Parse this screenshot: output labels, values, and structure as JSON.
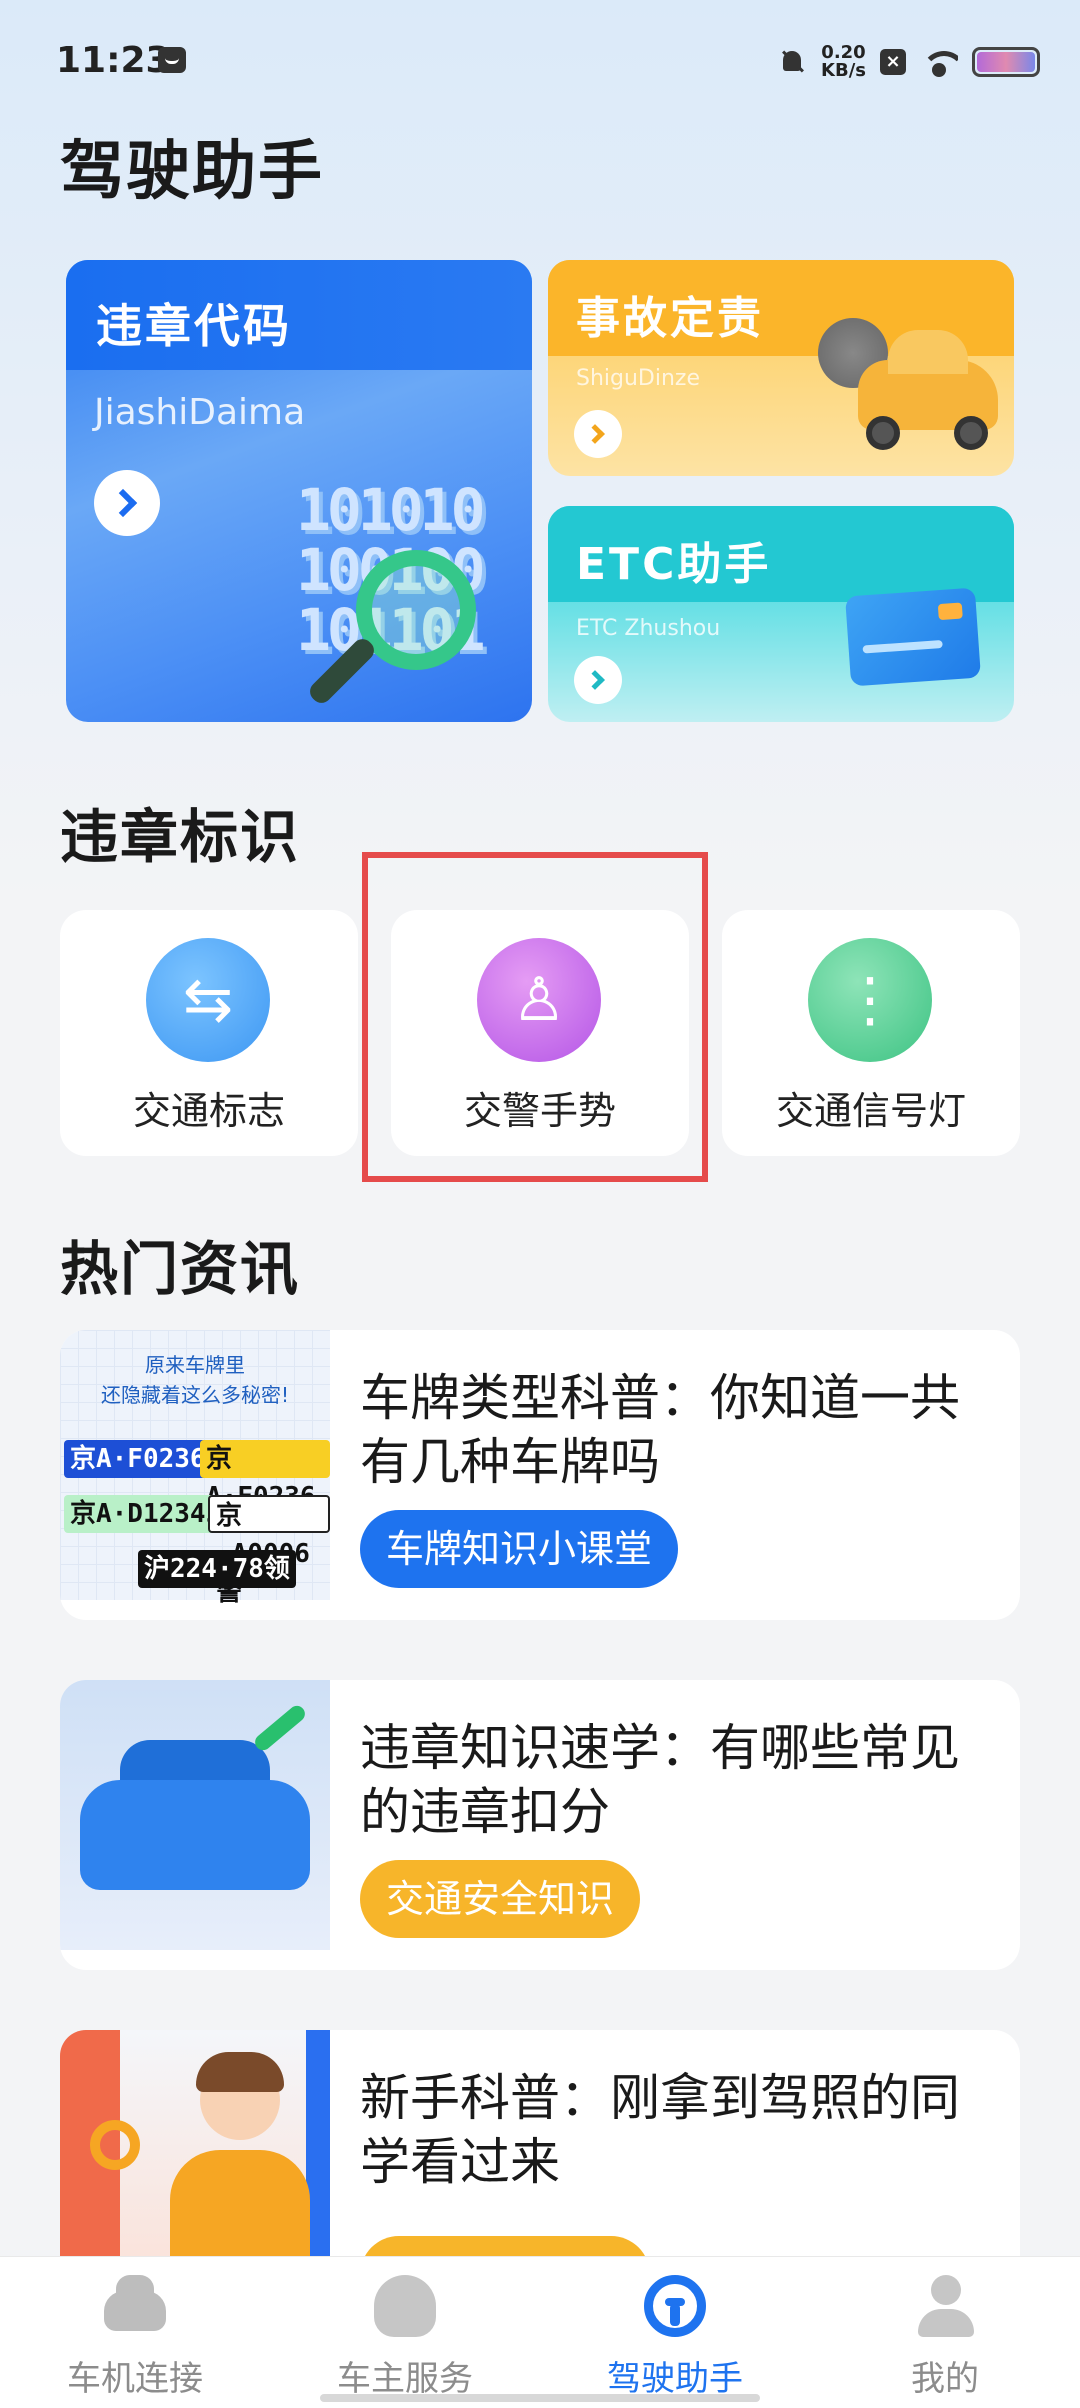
{
  "status_bar": {
    "time": "11:23",
    "net_speed": "0.20",
    "net_unit": "KB/s"
  },
  "page_title": "驾驶助手",
  "feature_cards": [
    {
      "title": "违章代码",
      "subtitle": "JiashiDaima"
    },
    {
      "title": "事故定责",
      "subtitle": "ShiguDinze"
    },
    {
      "title": "ETC助手",
      "subtitle": "ETC Zhushou"
    }
  ],
  "signs_section": {
    "title": "违章标识",
    "items": [
      {
        "label": "交通标志",
        "icon": "road-sign-icon"
      },
      {
        "label": "交警手势",
        "icon": "traffic-police-icon"
      },
      {
        "label": "交通信号灯",
        "icon": "traffic-light-icon"
      }
    ]
  },
  "news_section": {
    "title": "热门资讯",
    "items": [
      {
        "title": "车牌类型科普：你知道一共有几种车牌吗",
        "tag": "车牌知识小课堂",
        "tag_color": "#1e73ef"
      },
      {
        "title": "违章知识速学：有哪些常见的违章扣分",
        "tag": "交通安全知识",
        "tag_color": "#f7b52a"
      },
      {
        "title": "新手科普：刚拿到驾照的同学看过来",
        "tag": "",
        "tag_color": "#f7b52a"
      }
    ],
    "plate_thumb": {
      "heading_1": "原来车牌里",
      "heading_2": "还隐藏着这么多秘密!",
      "plates": [
        "京A·F0236",
        "京A·F0236",
        "京A·D12345",
        "京·A0006警",
        "沪224·78领"
      ]
    }
  },
  "bottom_nav": {
    "items": [
      {
        "label": "车机连接",
        "icon": "car-icon"
      },
      {
        "label": "车主服务",
        "icon": "service-icon"
      },
      {
        "label": "驾驶助手",
        "icon": "steering-wheel-icon"
      },
      {
        "label": "我的",
        "icon": "user-icon"
      }
    ],
    "active_index": 2,
    "active_color": "#1e73ef"
  }
}
